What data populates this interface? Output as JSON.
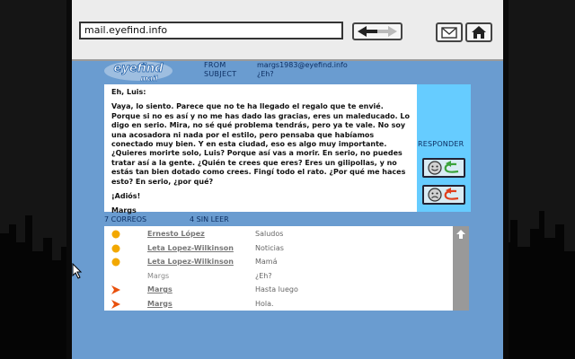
{
  "browser": {
    "url": "mail.eyefind.info"
  },
  "logo": {
    "line1": "eyefind",
    "line2": "mail"
  },
  "header": {
    "from_label": "FROM",
    "subject_label": "SUBJECT",
    "from_value": "margs1983@eyefind.info",
    "subject_value": "¿Eh?"
  },
  "message": {
    "greeting": "Eh, Luis:",
    "paragraph": "Vaya, lo siento. Parece que no te ha llegado el regalo que te envié. Porque si no es así y no me has dado las gracias, eres un maleducado. Lo digo en serio. Mira, no sé qué problema tendrás, pero ya te vale. No soy una acosadora ni nada por el estilo, pero pensaba que habíamos conectado muy bien. Y en esta ciudad, eso es algo muy importante. ¿Quieres morirte solo, Luis? Porque así vas a morir. En serio, no puedes tratar así a la gente. ¿Quién te crees que eres? Eres un gilipollas, y no estás tan bien dotado como crees. Fingí todo el rato. ¿Por qué me haces esto? En serio, ¿por qué?",
    "closing": "¡Adiós!",
    "signature": "Margs"
  },
  "reply": {
    "label": "RESPONDER"
  },
  "counts": {
    "total": "7 CORREOS",
    "unread": "4 SIN LEER"
  },
  "inbox": [
    {
      "status": "read-dot",
      "sender": "Ernesto López",
      "subject": "Saludos",
      "sender_style": "link"
    },
    {
      "status": "read-dot",
      "sender": "Leta Lopez-Wilkinson",
      "subject": "Noticias",
      "sender_style": "link"
    },
    {
      "status": "read-dot",
      "sender": "Leta Lopez-Wilkinson",
      "subject": "Mamá",
      "sender_style": "link"
    },
    {
      "status": "none",
      "sender": "Margs",
      "subject": "¿Eh?",
      "sender_style": "plain"
    },
    {
      "status": "unread-arrow",
      "sender": "Margs",
      "subject": "Hasta luego",
      "sender_style": "link"
    },
    {
      "status": "unread-arrow",
      "sender": "Margs",
      "subject": "Hola.",
      "sender_style": "link"
    }
  ],
  "colors": {
    "page_bg": "#6a9cd0",
    "reply_panel": "#66ccff",
    "header_text": "#0d2f63",
    "read_dot": "#f2a800",
    "unread_arrow": "#e8500c"
  }
}
